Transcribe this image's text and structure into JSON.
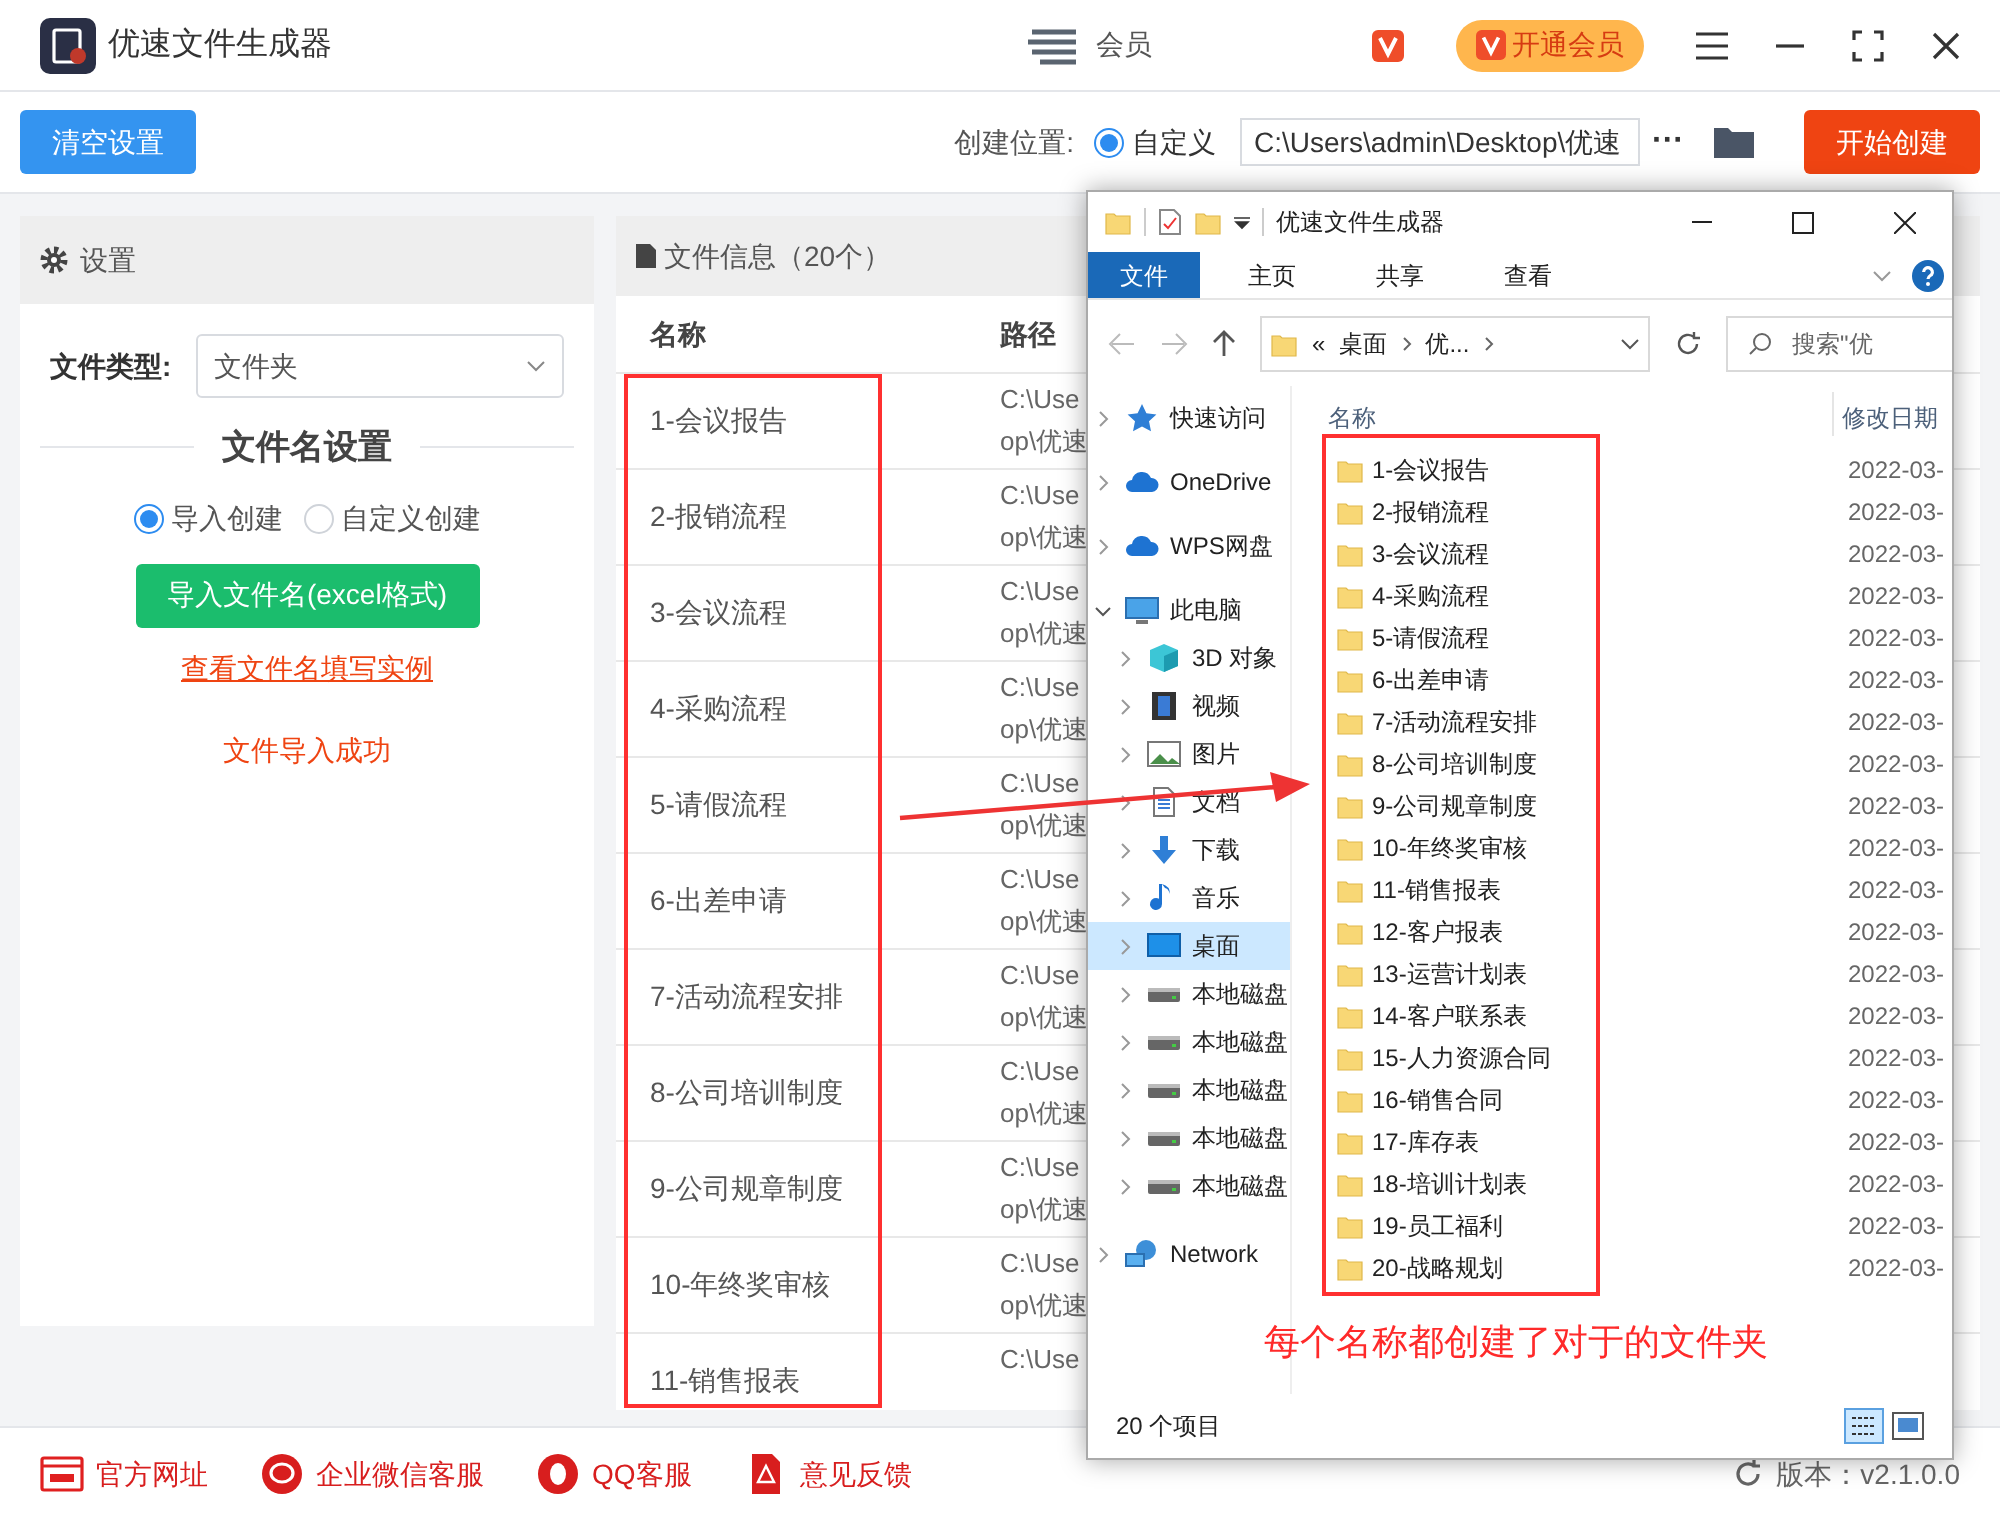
{
  "app": {
    "title": "优速文件生成器",
    "user_label": "会员",
    "vip_button": "开通会员"
  },
  "toolbar": {
    "clear_button": "清空设置",
    "location_label": "创建位置:",
    "location_option": {
      "label": "自定义",
      "selected": true
    },
    "path_value": "C:\\Users\\admin\\Desktop\\优速",
    "more_button": "···",
    "start_button": "开始创建"
  },
  "settings": {
    "title": "设置",
    "file_type_label": "文件类型:",
    "file_type_value": "文件夹",
    "section_title": "文件名设置",
    "modes": [
      {
        "label": "导入创建",
        "selected": true
      },
      {
        "label": "自定义创建",
        "selected": false
      }
    ],
    "import_button": "导入文件名(excel格式)",
    "example_link": "查看文件名填写实例",
    "status": "文件导入成功"
  },
  "file_info": {
    "title": "文件信息（20个）",
    "columns": [
      "名称",
      "路径"
    ],
    "rows": [
      {
        "name": "1-会议报告",
        "path": [
          "C:\\Use",
          "op\\优速"
        ]
      },
      {
        "name": "2-报销流程",
        "path": [
          "C:\\Use",
          "op\\优速"
        ]
      },
      {
        "name": "3-会议流程",
        "path": [
          "C:\\Use",
          "op\\优速"
        ]
      },
      {
        "name": "4-采购流程",
        "path": [
          "C:\\Use",
          "op\\优速"
        ]
      },
      {
        "name": "5-请假流程",
        "path": [
          "C:\\Use",
          "op\\优速"
        ]
      },
      {
        "name": "6-出差申请",
        "path": [
          "C:\\Use",
          "op\\优速"
        ]
      },
      {
        "name": "7-活动流程安排",
        "path": [
          "C:\\Use",
          "op\\优速"
        ]
      },
      {
        "name": "8-公司培训制度",
        "path": [
          "C:\\Use",
          "op\\优速"
        ]
      },
      {
        "name": "9-公司规章制度",
        "path": [
          "C:\\Use",
          "op\\优速"
        ]
      },
      {
        "name": "10-年终奖审核",
        "path": [
          "C:\\Use",
          "op\\优速"
        ]
      },
      {
        "name": "11-销售报表",
        "path": [
          "C:\\Use"
        ]
      }
    ]
  },
  "explorer": {
    "title": "优速文件生成器",
    "ribbon_tabs": [
      {
        "label": "文件",
        "selected": true
      },
      {
        "label": "主页",
        "selected": false
      },
      {
        "label": "共享",
        "selected": false
      },
      {
        "label": "查看",
        "selected": false
      }
    ],
    "address": [
      "«",
      "桌面",
      "优..."
    ],
    "search_placeholder": "搜索\"优",
    "nav": [
      {
        "label": "快速访问",
        "kind": "star",
        "selected": false,
        "expanded": false
      },
      {
        "label": "OneDrive",
        "kind": "cloud",
        "selected": false,
        "expanded": false
      },
      {
        "label": "WPS网盘",
        "kind": "cloud",
        "selected": false,
        "expanded": false
      },
      {
        "label": "此电脑",
        "kind": "pc",
        "selected": false,
        "expanded": true,
        "children": [
          {
            "label": "3D 对象",
            "kind": "cube",
            "selected": false,
            "expanded": false
          },
          {
            "label": "视频",
            "kind": "film",
            "selected": false,
            "expanded": false
          },
          {
            "label": "图片",
            "kind": "image",
            "selected": false,
            "expanded": false
          },
          {
            "label": "文档",
            "kind": "doc",
            "selected": false,
            "expanded": false
          },
          {
            "label": "下载",
            "kind": "download",
            "selected": false,
            "expanded": false
          },
          {
            "label": "音乐",
            "kind": "music",
            "selected": false,
            "expanded": false
          },
          {
            "label": "桌面",
            "kind": "desktop",
            "selected": true,
            "expanded": false
          },
          {
            "label": "本地磁盘",
            "kind": "drive",
            "selected": false,
            "expanded": false
          },
          {
            "label": "本地磁盘",
            "kind": "drive",
            "selected": false,
            "expanded": false
          },
          {
            "label": "本地磁盘",
            "kind": "drive",
            "selected": false,
            "expanded": false
          },
          {
            "label": "本地磁盘",
            "kind": "drive",
            "selected": false,
            "expanded": false
          },
          {
            "label": "本地磁盘",
            "kind": "drive",
            "selected": false,
            "expanded": false
          }
        ]
      },
      {
        "label": "Network",
        "kind": "network",
        "selected": false,
        "expanded": false
      }
    ],
    "columns": [
      "名称",
      "修改日期"
    ],
    "files": [
      {
        "name": "1-会议报告",
        "date": "2022-03-"
      },
      {
        "name": "2-报销流程",
        "date": "2022-03-"
      },
      {
        "name": "3-会议流程",
        "date": "2022-03-"
      },
      {
        "name": "4-采购流程",
        "date": "2022-03-"
      },
      {
        "name": "5-请假流程",
        "date": "2022-03-"
      },
      {
        "name": "6-出差申请",
        "date": "2022-03-"
      },
      {
        "name": "7-活动流程安排",
        "date": "2022-03-"
      },
      {
        "name": "8-公司培训制度",
        "date": "2022-03-"
      },
      {
        "name": "9-公司规章制度",
        "date": "2022-03-"
      },
      {
        "name": "10-年终奖审核",
        "date": "2022-03-"
      },
      {
        "name": "11-销售报表",
        "date": "2022-03-"
      },
      {
        "name": "12-客户报表",
        "date": "2022-03-"
      },
      {
        "name": "13-运营计划表",
        "date": "2022-03-"
      },
      {
        "name": "14-客户联系表",
        "date": "2022-03-"
      },
      {
        "name": "15-人力资源合同",
        "date": "2022-03-"
      },
      {
        "name": "16-销售合同",
        "date": "2022-03-"
      },
      {
        "name": "17-库存表",
        "date": "2022-03-"
      },
      {
        "name": "18-培训计划表",
        "date": "2022-03-"
      },
      {
        "name": "19-员工福利",
        "date": "2022-03-"
      },
      {
        "name": "20-战略规划",
        "date": "2022-03-"
      }
    ],
    "status": "20 个项目"
  },
  "annotation": {
    "caption": "每个名称都创建了对于的文件夹"
  },
  "footer": {
    "links": [
      {
        "label": "官方网址",
        "kind": "web"
      },
      {
        "label": "企业微信客服",
        "kind": "chat"
      },
      {
        "label": "QQ客服",
        "kind": "qq"
      },
      {
        "label": "意见反馈",
        "kind": "pdf"
      }
    ],
    "version": "版本：v2.1.0.0"
  }
}
